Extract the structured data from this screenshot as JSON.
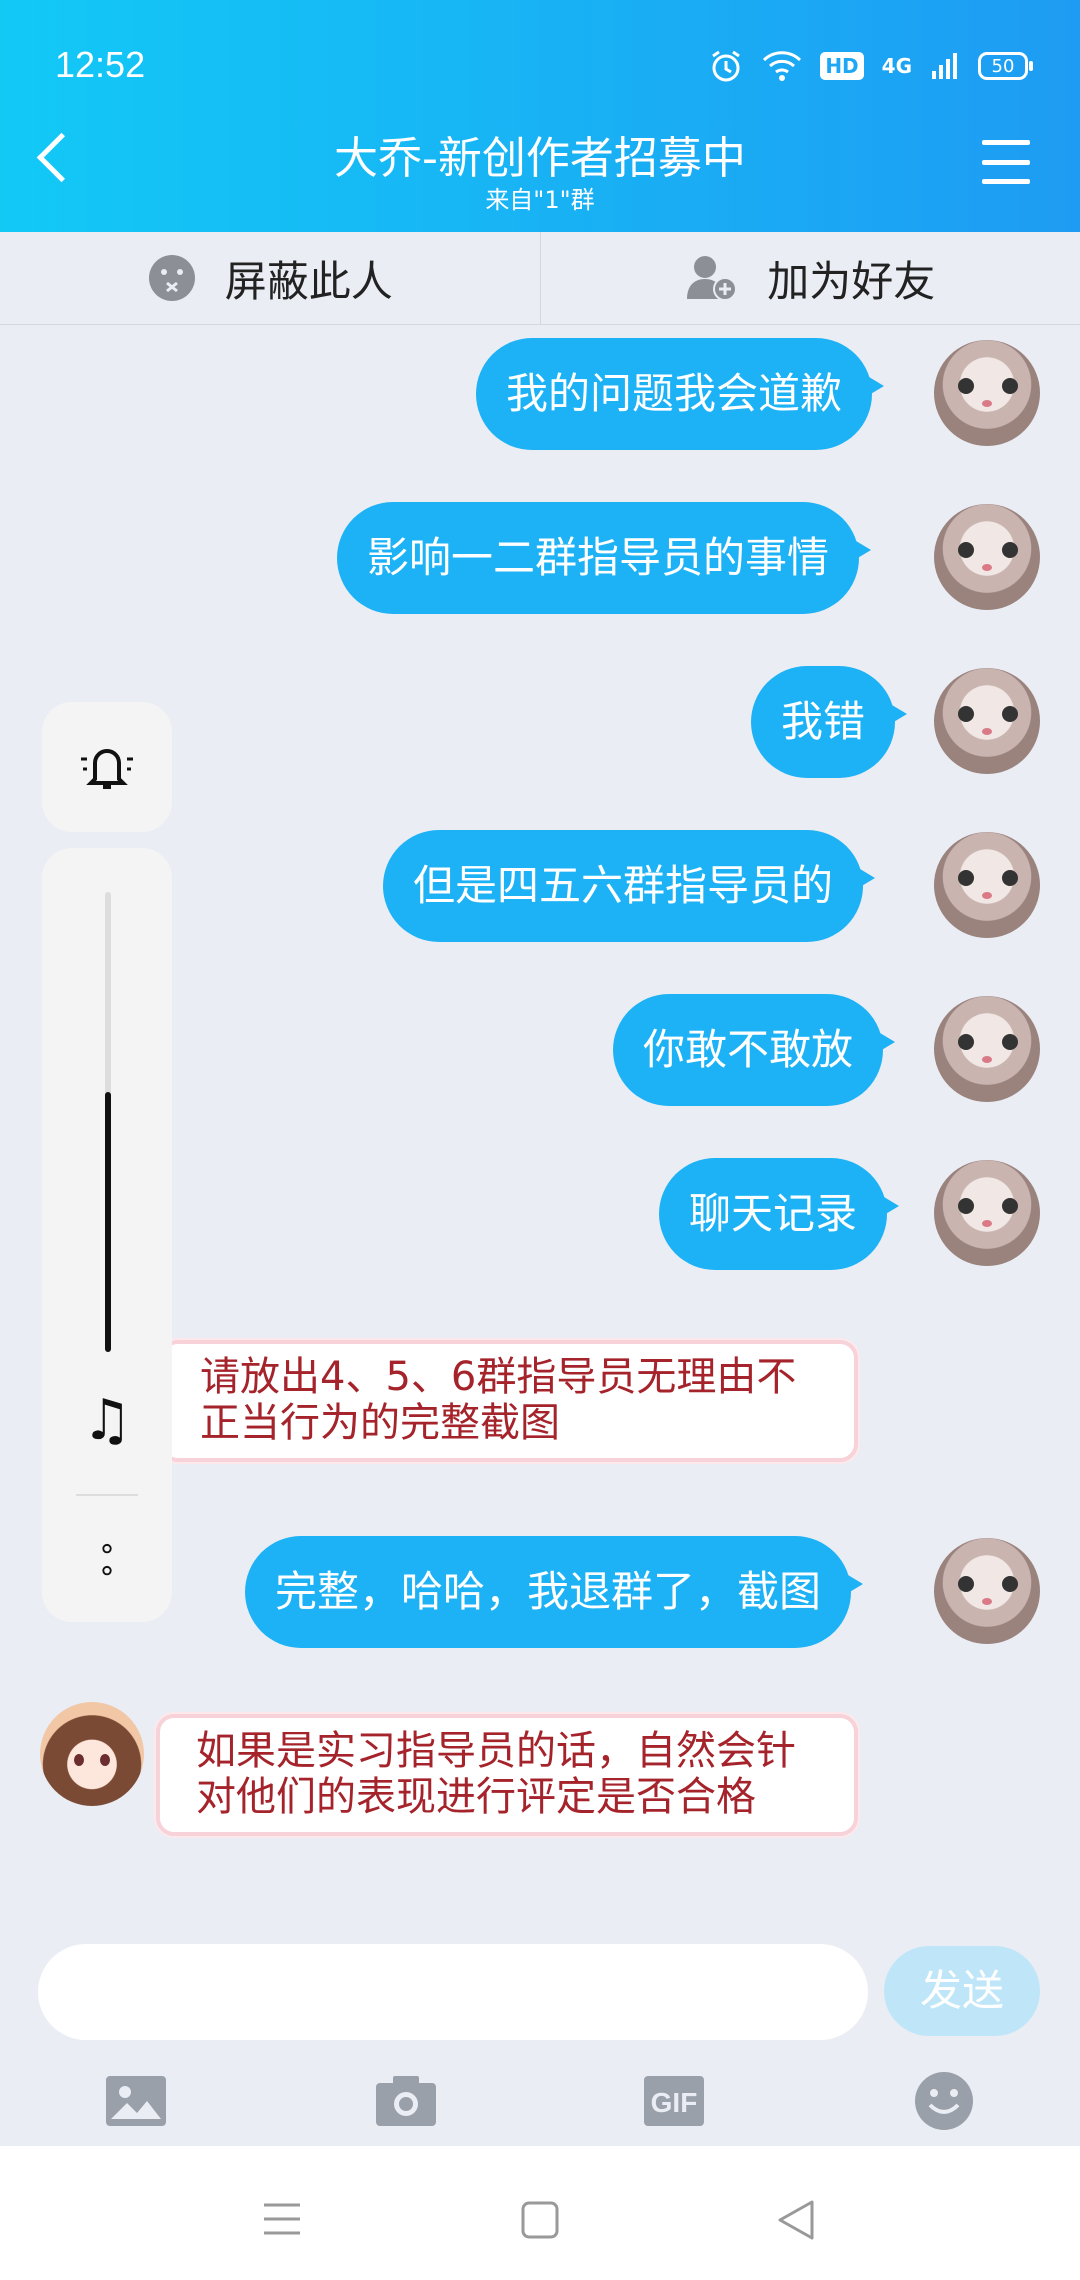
{
  "status_bar": {
    "time": "12:52",
    "hd": "HD",
    "network": "4G",
    "battery": "50"
  },
  "header": {
    "title": "大乔-新创作者招募中",
    "subtitle": "来自\"1\"群"
  },
  "actions": {
    "block_label": "屏蔽此人",
    "add_friend_label": "加为好友"
  },
  "messages": {
    "m1": "我的问题我会道歉",
    "m2": "影响一二群指导员的事情",
    "m3": "我错",
    "m4": "但是四五六群指导员的",
    "m5": "你敢不敢放",
    "m6": "聊天记录",
    "m7": "请放出4、5、6群指导员无理由不正当行为的完整截图",
    "m8": "完整，哈哈，我退群了，截图",
    "m9": "如果是实习指导员的话，自然会针对他们的表现进行评定是否合格"
  },
  "input": {
    "placeholder": "",
    "send_label": "发送"
  },
  "volume": {
    "level": 0.55
  }
}
